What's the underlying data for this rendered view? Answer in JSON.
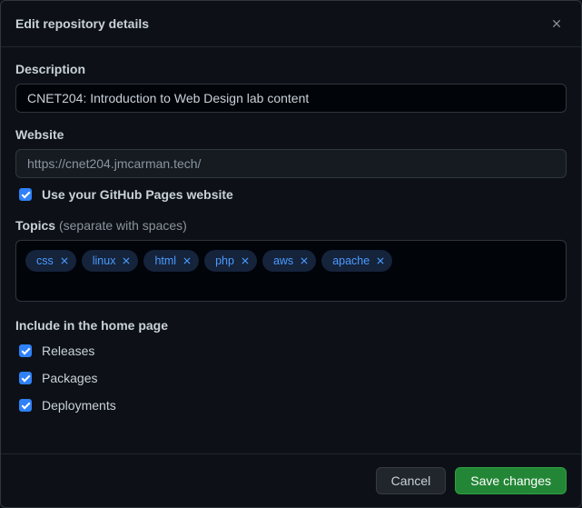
{
  "header": {
    "title": "Edit repository details"
  },
  "description": {
    "label": "Description",
    "value": "CNET204: Introduction to Web Design lab content"
  },
  "website": {
    "label": "Website",
    "value": "https://cnet204.jmcarman.tech/",
    "use_pages_label": "Use your GitHub Pages website",
    "use_pages_checked": true
  },
  "topics": {
    "label": "Topics",
    "hint": "(separate with spaces)",
    "items": [
      "css",
      "linux",
      "html",
      "php",
      "aws",
      "apache"
    ]
  },
  "include": {
    "heading": "Include in the home page",
    "items": [
      {
        "label": "Releases",
        "checked": true
      },
      {
        "label": "Packages",
        "checked": true
      },
      {
        "label": "Deployments",
        "checked": true
      }
    ]
  },
  "footer": {
    "cancel": "Cancel",
    "save": "Save changes"
  }
}
